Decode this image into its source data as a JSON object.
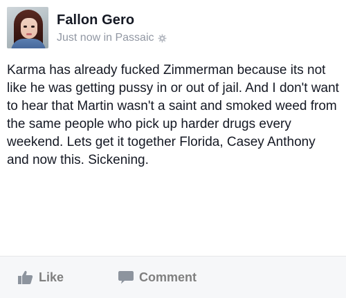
{
  "post": {
    "author": "Fallon Gero",
    "meta": "Just now in Passaic",
    "body": "Karma has already fucked Zimmerman because its not like he was getting pussy in or out of jail. And I don't want to hear that Martin wasn't a saint and smoked weed from the same people who pick up harder drugs every weekend. Lets get it together Florida, Casey Anthony and now this. Sickening."
  },
  "actions": {
    "like_label": "Like",
    "comment_label": "Comment"
  },
  "icons": {
    "privacy": "gear-icon",
    "like": "thumbs-up-icon",
    "comment": "comment-bubble-icon"
  },
  "colors": {
    "text": "#141823",
    "meta": "#9197a3",
    "action": "#7f7f7f",
    "action_bar": "#f6f7f9"
  }
}
